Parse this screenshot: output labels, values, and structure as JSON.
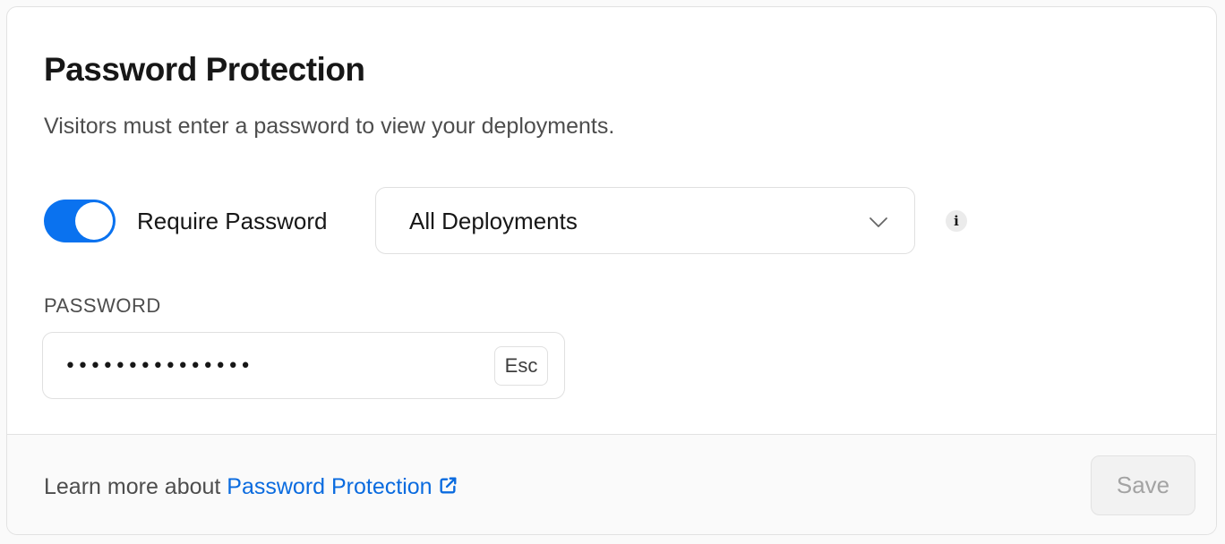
{
  "section": {
    "title": "Password Protection",
    "description": "Visitors must enter a password to view your deployments."
  },
  "require_password": {
    "label": "Require Password",
    "enabled": true,
    "accent_color": "#0a72ef"
  },
  "scope_select": {
    "selected": "All Deployments",
    "icon": "chevron-down-icon"
  },
  "info": {
    "icon": "info-icon",
    "glyph": "i"
  },
  "password_field": {
    "label": "PASSWORD",
    "value": "•••••••••••••••",
    "clear_key": "Esc"
  },
  "footer": {
    "learn_prefix": "Learn more about ",
    "learn_link": "Password Protection",
    "link_icon": "external-link-icon",
    "link_color": "#0a6bdf",
    "save_label": "Save",
    "save_disabled": true
  }
}
